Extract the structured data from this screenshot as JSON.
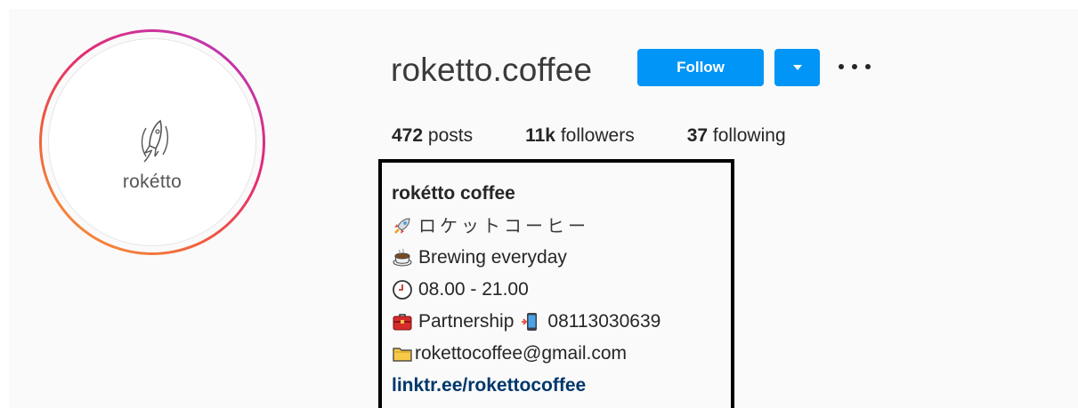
{
  "profile": {
    "username": "roketto.coffee",
    "avatar_text": "rokétto",
    "follow_label": "Follow"
  },
  "stats": {
    "posts_count": "472",
    "posts_label": "posts",
    "followers_count": "11k",
    "followers_label": "followers",
    "following_count": "37",
    "following_label": "following"
  },
  "bio": {
    "name": "rokétto coffee",
    "lines": [
      {
        "icon": "rocket-icon",
        "text": "ロケットコーヒー"
      },
      {
        "icon": "coffee-cup-icon",
        "text": "Brewing everyday"
      },
      {
        "icon": "clock-icon",
        "text": "08.00 - 21.00"
      },
      {
        "icon": "briefcase-icon",
        "text": "Partnership"
      },
      {
        "icon": "folder-icon",
        "text": "rokettocoffee@gmail.com"
      }
    ],
    "phone_icon": "mobile-phone-icon",
    "phone": "08113030639",
    "link": "linktr.ee/rokettocoffee"
  },
  "colors": {
    "accent": "#0095f6",
    "link": "#00376b",
    "background": "#fafafa"
  }
}
